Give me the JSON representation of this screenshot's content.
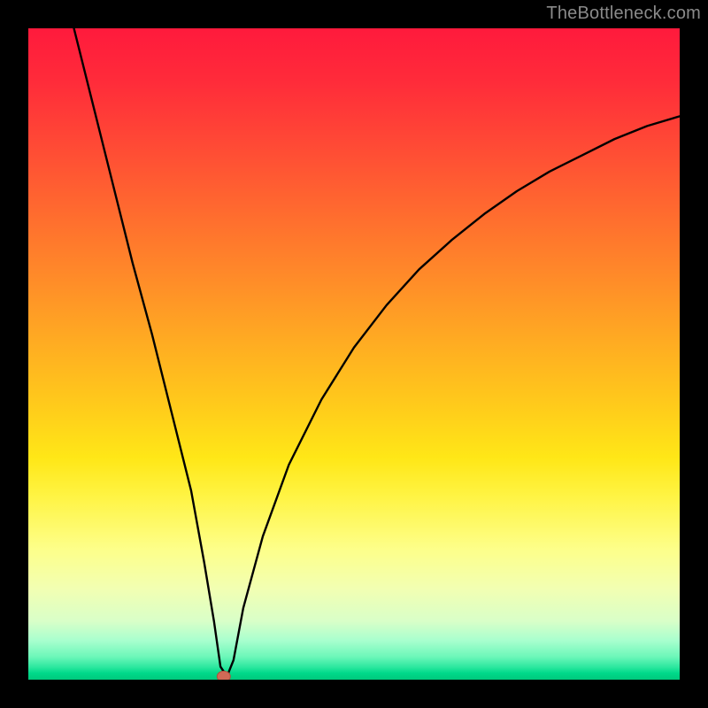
{
  "watermark": "TheBottleneck.com",
  "colors": {
    "frame": "#000000",
    "curve": "#000000",
    "marker_fill": "#d06a56",
    "marker_stroke": "#b34c3c",
    "gradient_top": "#ff1a3c",
    "gradient_bottom": "#00c97c"
  },
  "chart_data": {
    "type": "line",
    "title": "",
    "xlabel": "",
    "ylabel": "",
    "xlim": [
      0,
      100
    ],
    "ylim": [
      0,
      100
    ],
    "grid": false,
    "marker": {
      "x": 30,
      "y": 0.5
    },
    "series": [
      {
        "name": "bottleneck-curve",
        "x": [
          7,
          10,
          13,
          16,
          19,
          22,
          25,
          27,
          28.5,
          29.5,
          30.5,
          31.5,
          33,
          36,
          40,
          45,
          50,
          55,
          60,
          65,
          70,
          75,
          80,
          85,
          90,
          95,
          100
        ],
        "values": [
          100,
          88,
          76,
          64,
          53,
          41,
          29,
          18,
          9,
          2,
          0.5,
          3,
          11,
          22,
          33,
          43,
          51,
          57.5,
          63,
          67.5,
          71.5,
          75,
          78,
          80.5,
          83,
          85,
          86.5
        ]
      }
    ],
    "annotations": []
  }
}
